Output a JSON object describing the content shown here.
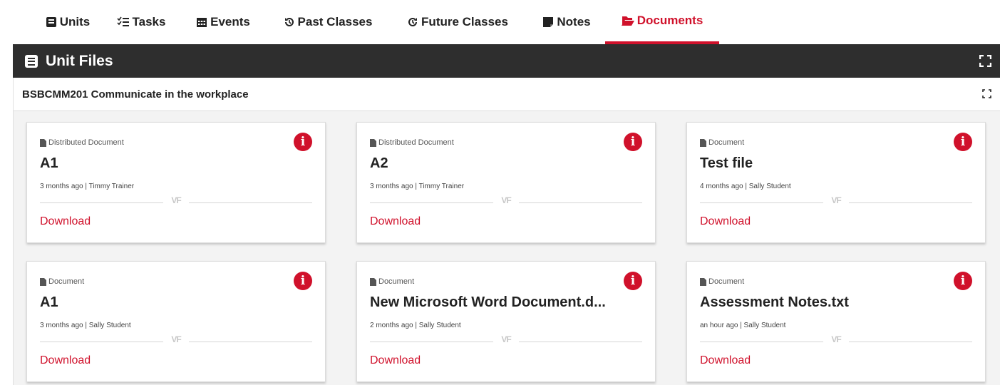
{
  "tabs": [
    {
      "label": "Units",
      "icon": "book-icon"
    },
    {
      "label": "Tasks",
      "icon": "checklist-icon"
    },
    {
      "label": "Events",
      "icon": "calendar-icon"
    },
    {
      "label": "Past Classes",
      "icon": "history-icon"
    },
    {
      "label": "Future Classes",
      "icon": "forward-clock-icon"
    },
    {
      "label": "Notes",
      "icon": "note-icon"
    },
    {
      "label": "Documents",
      "icon": "folder-open-icon",
      "active": true
    }
  ],
  "panel": {
    "title": "Unit Files"
  },
  "unit": {
    "title": "BSBCMM201 Communicate in the workplace"
  },
  "cards": [
    {
      "type": "Distributed Document",
      "name": "A1",
      "meta": "3 months ago | Timmy Trainer",
      "action": "Download"
    },
    {
      "type": "Distributed Document",
      "name": "A2",
      "meta": "3 months ago | Timmy Trainer",
      "action": "Download"
    },
    {
      "type": "Document",
      "name": "Test file",
      "meta": "4 months ago | Sally Student",
      "action": "Download"
    },
    {
      "type": "Document",
      "name": "A1",
      "meta": "3 months ago | Sally Student",
      "action": "Download"
    },
    {
      "type": "Document",
      "name": "New Microsoft Word Document.d...",
      "meta": "2 months ago | Sally Student",
      "action": "Download"
    },
    {
      "type": "Document",
      "name": "Assessment Notes.txt",
      "meta": "an hour ago | Sally Student",
      "action": "Download"
    }
  ],
  "card_logo_text": "VF",
  "colors": {
    "accent": "#d0112b",
    "header_bg": "#2e2e2e",
    "content_bg": "#f3f3f3"
  }
}
